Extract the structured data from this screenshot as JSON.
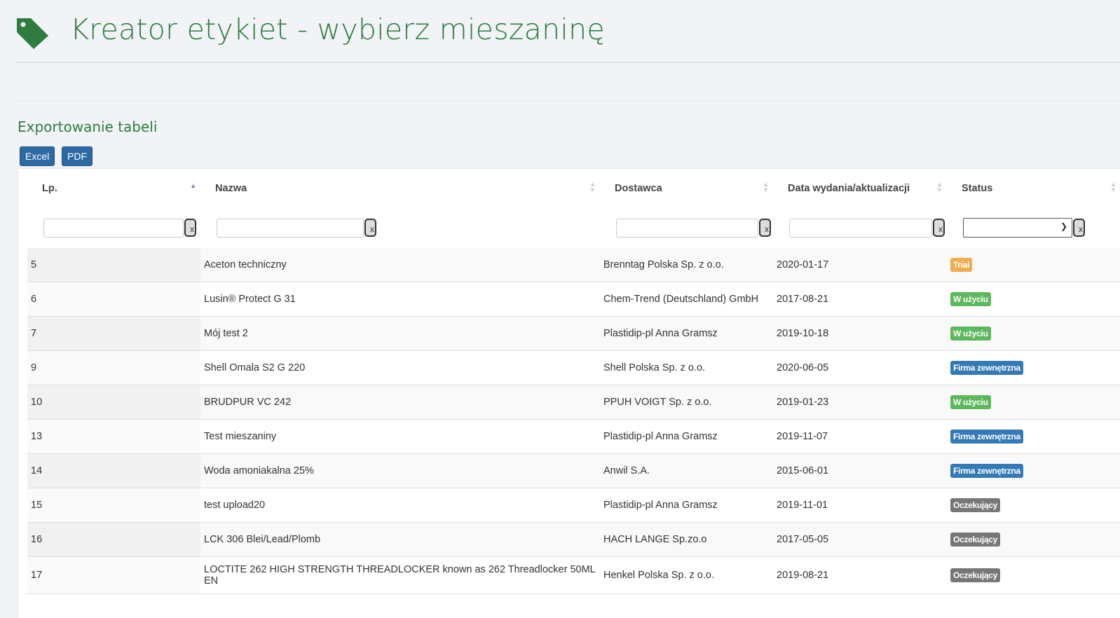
{
  "header": {
    "title": "Kreator etykiet - wybierz mieszaninę",
    "icon": "tag-icon"
  },
  "export": {
    "title": "Exportowanie tabeli",
    "excel": "Excel",
    "pdf": "PDF"
  },
  "table": {
    "columns": [
      "Lp.",
      "Nazwa",
      "Dostawca",
      "Data wydania/aktualizacji",
      "Status"
    ],
    "filter_clear": "x",
    "rows": [
      {
        "lp": "5",
        "nazwa": "Aceton techniczny",
        "dostawca": "Brenntag Polska Sp. z o.o.",
        "data": "2020-01-17",
        "status": "Trial",
        "color": "#f0ad4e"
      },
      {
        "lp": "6",
        "nazwa": "Lusin® Protect G 31",
        "dostawca": "Chem-Trend (Deutschland) GmbH",
        "data": "2017-08-21",
        "status": "W użyciu",
        "color": "#5cb85c"
      },
      {
        "lp": "7",
        "nazwa": "Mój test 2",
        "dostawca": "Plastidip-pl Anna Gramsz",
        "data": "2019-10-18",
        "status": "W użyciu",
        "color": "#5cb85c"
      },
      {
        "lp": "9",
        "nazwa": "Shell Omala S2 G 220",
        "dostawca": "Shell Polska Sp. z o.o.",
        "data": "2020-06-05",
        "status": "Firma zewnętrzna",
        "color": "#337ab7"
      },
      {
        "lp": "10",
        "nazwa": "BRUDPUR VC 242",
        "dostawca": "PPUH VOIGT Sp. z o.o.",
        "data": "2019-01-23",
        "status": "W użyciu",
        "color": "#5cb85c"
      },
      {
        "lp": "13",
        "nazwa": "Test mieszaniny",
        "dostawca": "Plastidip-pl Anna Gramsz",
        "data": "2019-11-07",
        "status": "Firma zewnętrzna",
        "color": "#337ab7"
      },
      {
        "lp": "14",
        "nazwa": "Woda amoniakalna 25%",
        "dostawca": "Anwil S.A.",
        "data": "2015-06-01",
        "status": "Firma zewnętrzna",
        "color": "#337ab7"
      },
      {
        "lp": "15",
        "nazwa": "test upload20",
        "dostawca": "Plastidip-pl Anna Gramsz",
        "data": "2019-11-01",
        "status": "Oczekujący",
        "color": "#777777"
      },
      {
        "lp": "16",
        "nazwa": "LCK 306 Blei/Lead/Plomb",
        "dostawca": "HACH LANGE Sp.zo.o",
        "data": "2017-05-05",
        "status": "Oczekujący",
        "color": "#777777"
      },
      {
        "lp": "17",
        "nazwa": "LOCTITE 262 HIGH STRENGTH THREADLOCKER known as 262 Threadlocker 50ML EN",
        "dostawca": "Henkel Polska Sp. z o.o.",
        "data": "2019-08-21",
        "status": "Oczekujący",
        "color": "#777777"
      }
    ]
  }
}
